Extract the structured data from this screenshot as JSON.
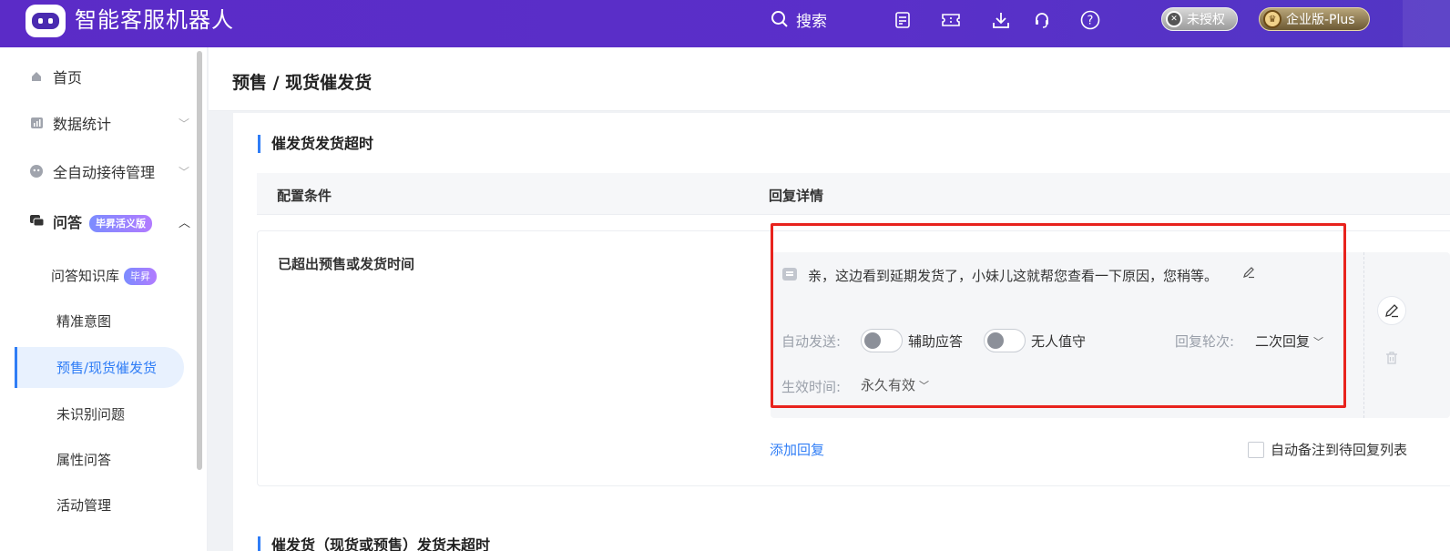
{
  "header": {
    "app_title": "智能客服机器人",
    "search_label": "搜索",
    "toolbar_icons": [
      "task-list-icon",
      "ticket-icon",
      "download-icon",
      "headset-icon",
      "help-icon"
    ],
    "auth_badge": "未授权",
    "edition_badge": "企业版-Plus",
    "brand_color": "#5b2bc7"
  },
  "sidebar": {
    "items": [
      {
        "label": "首页",
        "icon": "home-icon"
      },
      {
        "label": "数据统计",
        "icon": "chart-icon"
      },
      {
        "label": "全自动接待管理",
        "icon": "robot-face-icon"
      },
      {
        "label": "问答",
        "icon": "chat-icon",
        "badge": "毕昇活义版"
      }
    ],
    "sub_items": [
      {
        "label": "问答知识库",
        "badge": "毕昇"
      },
      {
        "label": "精准意图"
      },
      {
        "label": "预售/现货催发货",
        "active": true
      },
      {
        "label": "未识别问题"
      },
      {
        "label": "属性问答"
      },
      {
        "label": "活动管理"
      }
    ]
  },
  "main": {
    "page_title": "预售 / 现货催发货",
    "section_title": "催发货发货超时",
    "columns": [
      "配置条件",
      "回复详情"
    ],
    "row": {
      "condition": "已超出预售或发货时间",
      "reply_text": "亲，这边看到延期发货了，小妹儿这就帮您查看一下原因，您稍等。",
      "auto_send_label": "自动发送:",
      "toggle_assist_label": "辅助应答",
      "toggle_unattended_label": "无人值守",
      "reply_round_label": "回复轮次:",
      "reply_round_value": "二次回复",
      "effective_time_label": "生效时间:",
      "effective_time_value": "永久有效",
      "toggle_assist_on": false,
      "toggle_unattended_on": false
    },
    "add_reply": "添加回复",
    "auto_note_label": "自动备注到待回复列表",
    "auto_note_checked": false,
    "next_section_title": "催发货（现货或预售）发货未超时",
    "accent_color": "#2f7df6",
    "highlight_color": "#e8231d"
  }
}
